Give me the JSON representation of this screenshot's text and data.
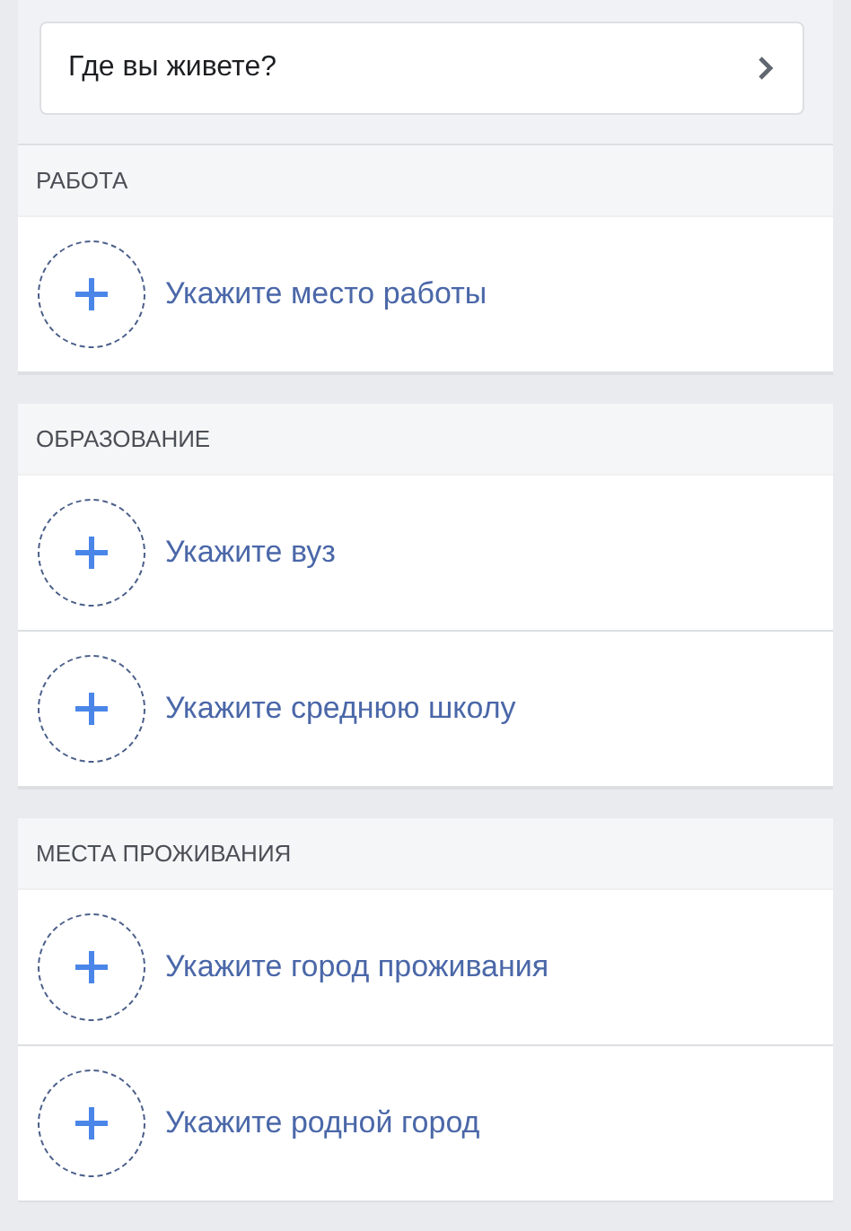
{
  "location_prompt": {
    "label": "Где вы живете?"
  },
  "sections": [
    {
      "title": "РАБОТА",
      "items": [
        {
          "label": "Укажите место работы"
        }
      ]
    },
    {
      "title": "ОБРАЗОВАНИЕ",
      "items": [
        {
          "label": "Укажите вуз"
        },
        {
          "label": "Укажите среднюю школу"
        }
      ]
    },
    {
      "title": "МЕСТА ПРОЖИВАНИЯ",
      "items": [
        {
          "label": "Укажите город проживания"
        },
        {
          "label": "Укажите родной город"
        }
      ]
    }
  ]
}
